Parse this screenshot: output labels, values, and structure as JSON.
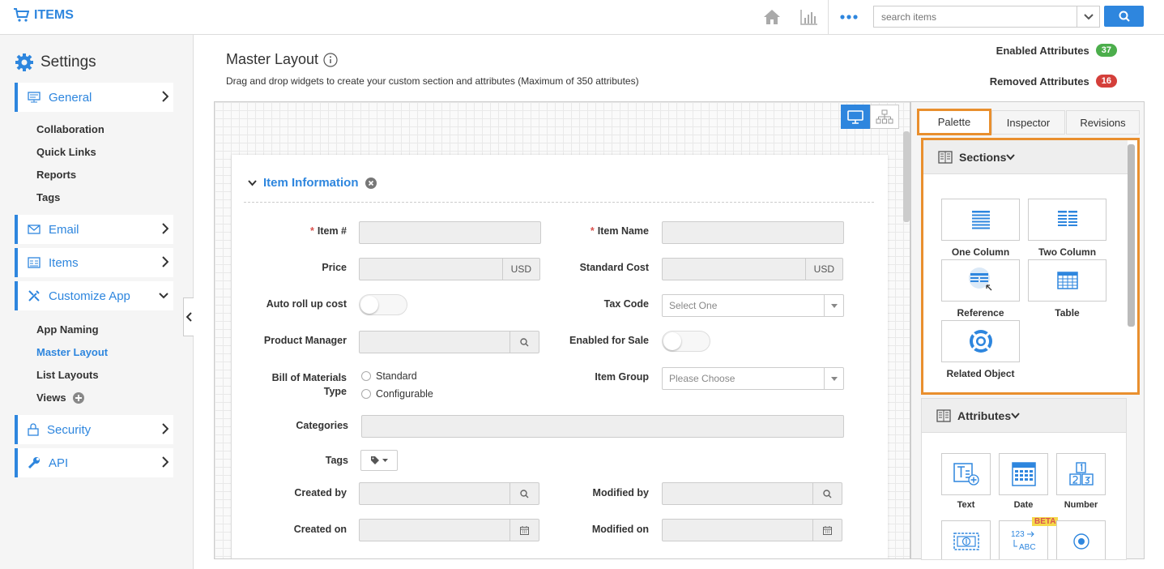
{
  "app": {
    "title": "ITEMS"
  },
  "search": {
    "placeholder": "search items"
  },
  "sidebar": {
    "heading": "Settings",
    "general": "General",
    "general_items": [
      "Collaboration",
      "Quick Links",
      "Reports",
      "Tags"
    ],
    "email": "Email",
    "items": "Items",
    "customize": "Customize App",
    "customize_items": [
      "App Naming",
      "Master Layout",
      "List Layouts",
      "Views"
    ],
    "security": "Security",
    "api": "API"
  },
  "page": {
    "title": "Master Layout",
    "subtitle": "Drag and drop widgets to create your custom section and attributes (Maximum of 350 attributes)",
    "enabled_label": "Enabled Attributes",
    "enabled_count": "37",
    "removed_label": "Removed Attributes",
    "removed_count": "16"
  },
  "form": {
    "section_title": "Item Information",
    "req_mark": "*",
    "item_no": "Item #",
    "item_name": "Item Name",
    "price": "Price",
    "currency": "USD",
    "standard_cost": "Standard Cost",
    "auto_roll": "Auto roll up cost",
    "tax_code": "Tax Code",
    "tax_code_ph": "Select One",
    "product_manager": "Product Manager",
    "enabled_sale": "Enabled for Sale",
    "bom_type_1": "Bill of Materials",
    "bom_type_2": "Type",
    "bom_standard": "Standard",
    "bom_configurable": "Configurable",
    "item_group": "Item Group",
    "item_group_ph": "Please Choose",
    "categories": "Categories",
    "tags": "Tags",
    "created_by": "Created by",
    "modified_by": "Modified by",
    "created_on": "Created on",
    "modified_on": "Modified on"
  },
  "palette": {
    "tabs": [
      "Palette",
      "Inspector",
      "Revisions"
    ],
    "sections_header": "Sections",
    "sections": [
      "One Column",
      "Two Column",
      "Reference",
      "Table",
      "Related Object"
    ],
    "attributes_header": "Attributes",
    "attributes": [
      "Text",
      "Date",
      "Number"
    ],
    "beta_label": "BETA"
  },
  "colors": {
    "accent": "#2e86de",
    "highlight": "#e98f2e",
    "green_badge": "#4cae4c",
    "red_badge": "#d43f3a"
  }
}
